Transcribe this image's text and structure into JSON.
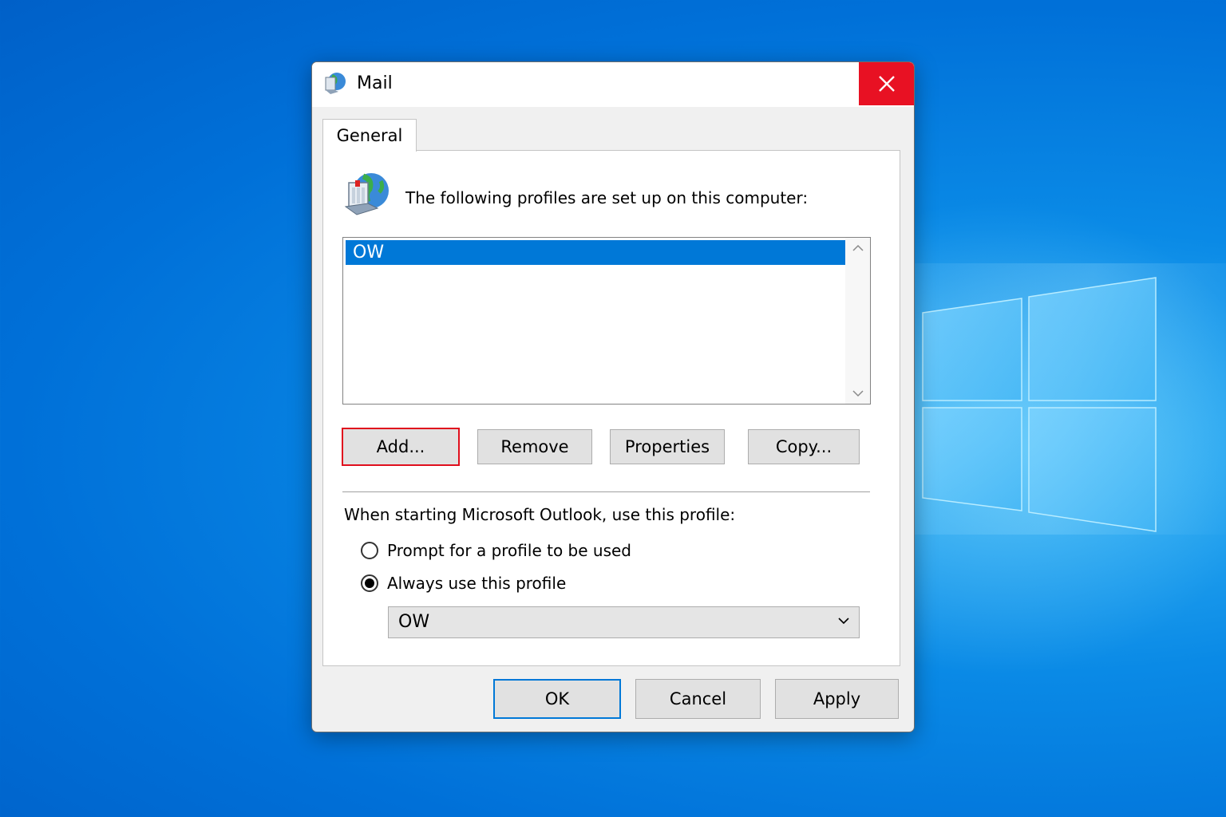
{
  "window": {
    "title": "Mail",
    "close_icon": "close-icon"
  },
  "tabs": [
    {
      "label": "General",
      "selected": true
    }
  ],
  "general": {
    "heading": "The following profiles are set up on this computer:",
    "profiles": [
      "OW"
    ],
    "selected_profile_index": 0,
    "buttons": {
      "add": "Add...",
      "remove": "Remove",
      "properties": "Properties",
      "copy": "Copy..."
    },
    "startup_label": "When starting Microsoft Outlook, use this profile:",
    "radio_prompt": "Prompt for a profile to be used",
    "radio_always": "Always use this profile",
    "selected_radio": "always",
    "profile_dropdown_value": "OW"
  },
  "dialog_buttons": {
    "ok": "OK",
    "cancel": "Cancel",
    "apply": "Apply"
  },
  "colors": {
    "selection": "#0078d7",
    "close_button": "#e81123",
    "highlight_border": "#e00f1d"
  }
}
